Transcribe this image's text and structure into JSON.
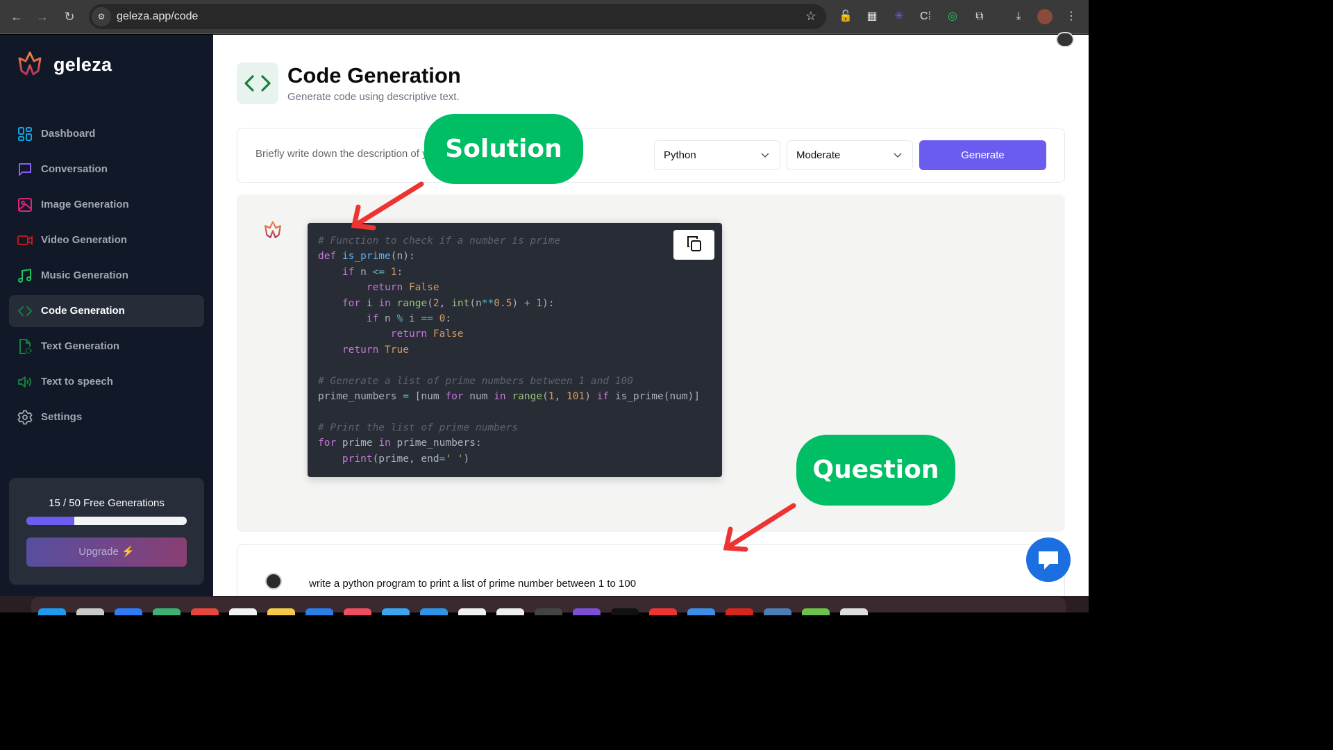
{
  "browser": {
    "url": "geleza.app/code",
    "back_icon": "arrow-left-icon",
    "forward_icon": "arrow-right-icon",
    "reload_icon": "reload-icon",
    "extensions": [
      "lock-icon",
      "extension-grid-icon",
      "asterisk-icon",
      "bracket-icon",
      "target-icon",
      "puzzle-icon",
      "download-icon",
      "profile-avatar",
      "more-icon"
    ]
  },
  "sidebar": {
    "brand": "geleza",
    "items": [
      {
        "label": "Dashboard",
        "icon": "dashboard-icon",
        "color": "#0ea5e9",
        "active": false
      },
      {
        "label": "Conversation",
        "icon": "chat-bubble-icon",
        "color": "#8b5cf6",
        "active": false
      },
      {
        "label": "Image Generation",
        "icon": "image-icon",
        "color": "#db2777",
        "active": false
      },
      {
        "label": "Video Generation",
        "icon": "video-icon",
        "color": "#b91c1c",
        "active": false
      },
      {
        "label": "Music Generation",
        "icon": "music-icon",
        "color": "#22c55e",
        "active": false
      },
      {
        "label": "Code Generation",
        "icon": "code-icon",
        "color": "#15803d",
        "active": true
      },
      {
        "label": "Text Generation",
        "icon": "file-text-icon",
        "color": "#15803d",
        "active": false
      },
      {
        "label": "Text to speech",
        "icon": "speaker-icon",
        "color": "#15803d",
        "active": false
      },
      {
        "label": "Settings",
        "icon": "gear-icon",
        "color": "#a1a7b3",
        "active": false
      }
    ],
    "usage": {
      "text": "15 / 50 Free Generations",
      "used": 15,
      "limit": 50,
      "progress_fraction": 0.3
    },
    "upgrade_label": "Upgrade"
  },
  "header": {
    "title": "Code Generation",
    "subtitle": "Generate code using descriptive text."
  },
  "form": {
    "prompt_placeholder": "Briefly write down the description of your code",
    "prompt_value": "",
    "language": "Python",
    "complexity": "Moderate",
    "generate_label": "Generate"
  },
  "response": {
    "code_lines": [
      [
        [
          "c-com",
          "# Function to check if a number is prime"
        ]
      ],
      [
        [
          "c-kw",
          "def "
        ],
        [
          "c-fn",
          "is_prime"
        ],
        [
          "",
          "(n):"
        ]
      ],
      [
        [
          "",
          "    "
        ],
        [
          "c-kw",
          "if"
        ],
        [
          "",
          " n "
        ],
        [
          "c-op",
          "<="
        ],
        [
          "",
          " "
        ],
        [
          "c-num",
          "1"
        ],
        [
          "",
          ":"
        ]
      ],
      [
        [
          "",
          "        "
        ],
        [
          "c-kw",
          "return "
        ],
        [
          "c-bool",
          "False"
        ]
      ],
      [
        [
          "",
          "    "
        ],
        [
          "c-kw",
          "for"
        ],
        [
          "",
          " i "
        ],
        [
          "c-kw",
          "in "
        ],
        [
          "c-bi",
          "range"
        ],
        [
          "",
          "("
        ],
        [
          "c-num",
          "2"
        ],
        [
          "",
          ", "
        ],
        [
          "c-bi",
          "int"
        ],
        [
          "",
          "(n"
        ],
        [
          "c-op",
          "**"
        ],
        [
          "c-num",
          "0.5"
        ],
        [
          "",
          ") "
        ],
        [
          "c-op",
          "+"
        ],
        [
          "",
          " "
        ],
        [
          "c-num",
          "1"
        ],
        [
          "",
          "):"
        ]
      ],
      [
        [
          "",
          "        "
        ],
        [
          "c-kw",
          "if"
        ],
        [
          "",
          " n "
        ],
        [
          "c-op",
          "%"
        ],
        [
          "",
          " i "
        ],
        [
          "c-op",
          "=="
        ],
        [
          "",
          " "
        ],
        [
          "c-num",
          "0"
        ],
        [
          "",
          ":"
        ]
      ],
      [
        [
          "",
          "            "
        ],
        [
          "c-kw",
          "return "
        ],
        [
          "c-bool",
          "False"
        ]
      ],
      [
        [
          "",
          "    "
        ],
        [
          "c-kw",
          "return "
        ],
        [
          "c-bool",
          "True"
        ]
      ],
      [
        [
          "",
          ""
        ]
      ],
      [
        [
          "c-com",
          "# Generate a list of prime numbers between 1 and 100"
        ]
      ],
      [
        [
          "",
          "prime_numbers "
        ],
        [
          "c-op",
          "="
        ],
        [
          "",
          " [num "
        ],
        [
          "c-kw",
          "for"
        ],
        [
          "",
          " num "
        ],
        [
          "c-kw",
          "in "
        ],
        [
          "c-bi",
          "range"
        ],
        [
          "",
          "("
        ],
        [
          "c-num",
          "1"
        ],
        [
          "",
          ", "
        ],
        [
          "c-num",
          "101"
        ],
        [
          "",
          ") "
        ],
        [
          "c-kw",
          "if"
        ],
        [
          "",
          " is_prime(num)]"
        ]
      ],
      [
        [
          "",
          ""
        ]
      ],
      [
        [
          "c-com",
          "# Print the list of prime numbers"
        ]
      ],
      [
        [
          "c-kw",
          "for"
        ],
        [
          "",
          " prime "
        ],
        [
          "c-kw",
          "in"
        ],
        [
          "",
          " prime_numbers:"
        ]
      ],
      [
        [
          "",
          "    "
        ],
        [
          "c-kw",
          "print"
        ],
        [
          "",
          "(prime, end"
        ],
        [
          "c-op",
          "="
        ],
        [
          "c-str",
          "' '"
        ],
        [
          "",
          ")"
        ]
      ]
    ],
    "copy_icon": "copy-icon"
  },
  "question": {
    "text": "write a python program to print a list of prime number between 1 to 100"
  },
  "annotations": {
    "solution_label": "Solution",
    "question_label": "Question",
    "color": "#00be64",
    "arrow_color": "#ee3333"
  }
}
